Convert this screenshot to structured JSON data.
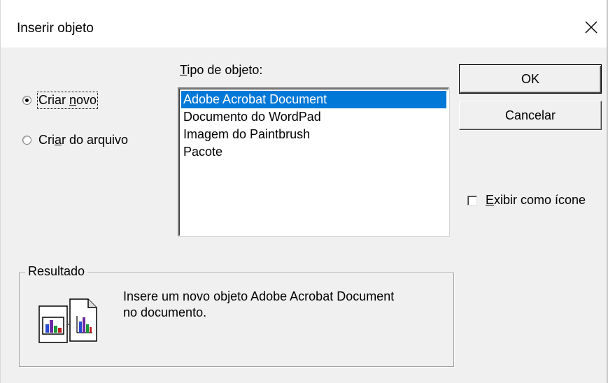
{
  "window": {
    "title": "Inserir objeto"
  },
  "options": {
    "create_new": {
      "label_pre": "Criar ",
      "label_u": "n",
      "label_post": "ovo",
      "checked": true
    },
    "create_from_file": {
      "label_pre": "Cri",
      "label_u": "a",
      "label_post": "r do arquivo",
      "checked": false
    }
  },
  "object_type": {
    "label_u": "T",
    "label_rest": "ipo de objeto:",
    "items": [
      "Adobe Acrobat Document",
      "Documento do WordPad",
      "Imagem do Paintbrush",
      "Pacote"
    ],
    "selected_index": 0
  },
  "buttons": {
    "ok": "OK",
    "cancel": "Cancelar"
  },
  "display_as_icon": {
    "label_u": "E",
    "label_rest": "xibir como ícone",
    "checked": false
  },
  "result": {
    "legend": "Resultado",
    "text_line1": "Insere um novo objeto Adobe Acrobat Document",
    "text_line2": "no documento."
  },
  "colors": {
    "selection": "#0078d7",
    "dialog_bg": "#f0f0f0"
  },
  "icons": {
    "close": "close-icon",
    "result": "insert-new-object-icon"
  }
}
